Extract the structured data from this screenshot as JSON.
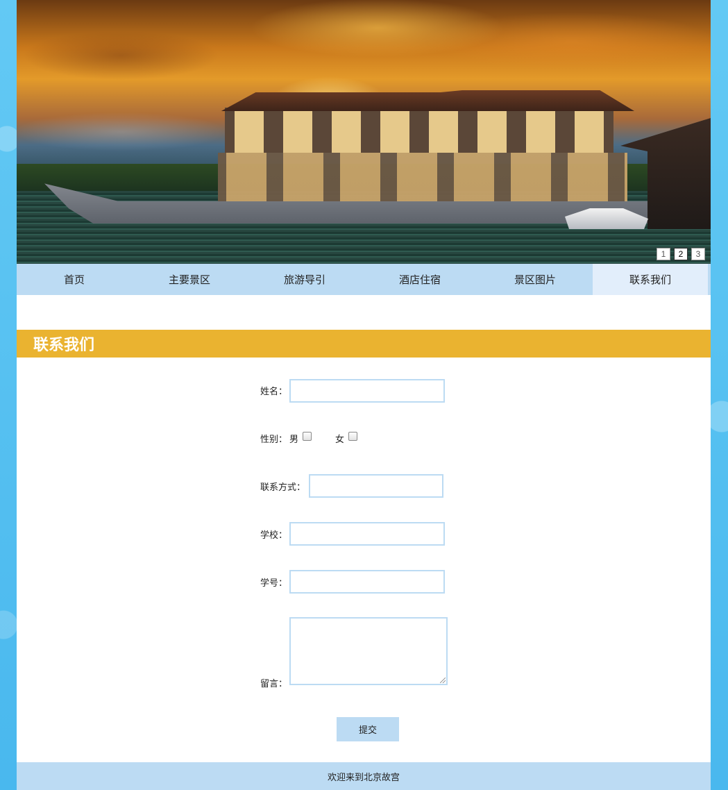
{
  "banner": {
    "slide_numbers": [
      "1",
      "2",
      "3"
    ],
    "active_slide": "2"
  },
  "nav": {
    "items": [
      {
        "label": "首页"
      },
      {
        "label": "主要景区"
      },
      {
        "label": "旅游导引"
      },
      {
        "label": "酒店住宿"
      },
      {
        "label": "景区图片"
      },
      {
        "label": "联系我们"
      }
    ],
    "active_index": 5
  },
  "section": {
    "title": "联系我们"
  },
  "form": {
    "name_label": "姓名：",
    "gender_label": "性别：",
    "gender_male": "男",
    "gender_female": "女",
    "contact_label": "联系方式：",
    "school_label": "学校：",
    "student_id_label": "学号：",
    "message_label": "留言：",
    "submit_label": "提交"
  },
  "footer": {
    "text": "欢迎来到北京故宫"
  },
  "colors": {
    "nav_bg": "#bcdbf3",
    "nav_active_bg": "#e2eefb",
    "section_bar": "#eab330",
    "page_bg": "#5cc6f2"
  }
}
